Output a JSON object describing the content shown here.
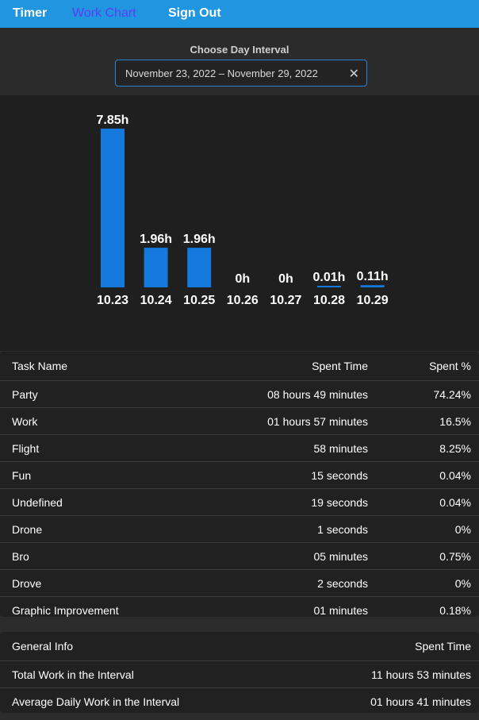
{
  "nav": {
    "timer": "Timer",
    "work_chart": "Work Chart",
    "sign_out": "Sign Out"
  },
  "interval": {
    "label": "Choose Day Interval",
    "value": "November 23, 2022 – November 29, 2022",
    "clear_icon": "close-icon"
  },
  "colors": {
    "nav_bg": "#2196e0",
    "active_link": "#5b3cf5",
    "bar": "#1478dc",
    "input_border": "#2b83d6"
  },
  "chart_data": {
    "type": "bar",
    "categories": [
      "10.23",
      "10.24",
      "10.25",
      "10.26",
      "10.27",
      "10.28",
      "10.29"
    ],
    "values": [
      7.85,
      1.96,
      1.96,
      0,
      0,
      0.01,
      0.11
    ],
    "value_labels": [
      "7.85h",
      "1.96h",
      "1.96h",
      "0h",
      "0h",
      "0.01h",
      "0.11h"
    ],
    "title": "",
    "xlabel": "",
    "ylabel": "",
    "grid": false
  },
  "tasks": {
    "headers": [
      "Task Name",
      "Spent Time",
      "Spent %"
    ],
    "rows": [
      [
        "Party",
        "08 hours 49 minutes",
        "74.24%"
      ],
      [
        "Work",
        "01 hours 57 minutes",
        "16.5%"
      ],
      [
        "Flight",
        "58 minutes",
        "8.25%"
      ],
      [
        "Fun",
        "15 seconds",
        "0.04%"
      ],
      [
        "Undefined",
        "19 seconds",
        "0.04%"
      ],
      [
        "Drone",
        "1 seconds",
        "0%"
      ],
      [
        "Bro",
        "05 minutes",
        "0.75%"
      ],
      [
        "Drove",
        "2 seconds",
        "0%"
      ],
      [
        "Graphic Improvement",
        "01 minutes",
        "0.18%"
      ]
    ]
  },
  "general": {
    "headers": [
      "General Info",
      "Spent Time"
    ],
    "rows": [
      [
        "Total Work in the Interval",
        "11 hours 53 minutes"
      ],
      [
        "Average Daily Work in the Interval",
        "01 hours 41 minutes"
      ]
    ]
  }
}
